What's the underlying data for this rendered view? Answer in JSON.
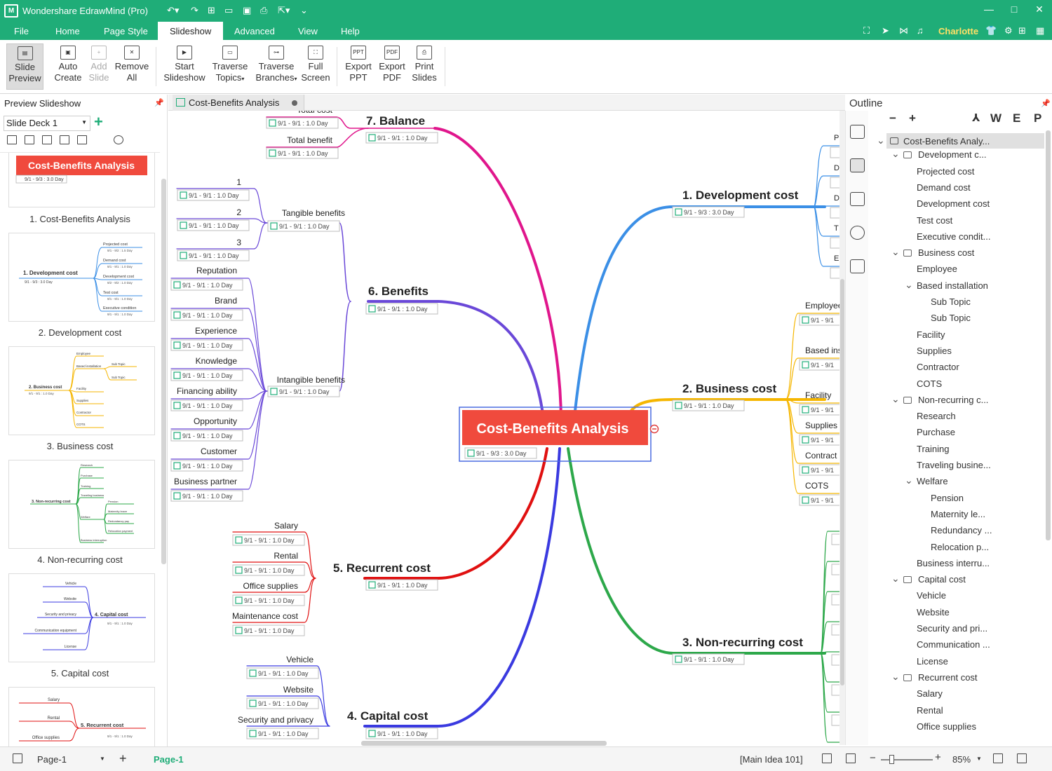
{
  "app": {
    "title": "Wondershare EdrawMind (Pro)",
    "user": "Charlotte"
  },
  "menu": [
    "File",
    "Home",
    "Page Style",
    "Slideshow",
    "Advanced",
    "View",
    "Help"
  ],
  "ribbon": [
    {
      "l1": "Slide",
      "l2": "Preview",
      "icon": "slide-preview-icon"
    },
    {
      "l1": "Auto",
      "l2": "Create",
      "icon": "auto-create-icon"
    },
    {
      "l1": "Add",
      "l2": "Slide",
      "icon": "add-slide-icon"
    },
    {
      "l1": "Remove",
      "l2": "All",
      "icon": "remove-all-icon"
    },
    {
      "l1": "Start",
      "l2": "Slideshow",
      "icon": "start-slideshow-icon"
    },
    {
      "l1": "Traverse",
      "l2": "Topics",
      "icon": "traverse-topics-icon"
    },
    {
      "l1": "Traverse",
      "l2": "Branches",
      "icon": "traverse-branches-icon"
    },
    {
      "l1": "Full",
      "l2": "Screen",
      "icon": "full-screen-icon"
    },
    {
      "l1": "Export",
      "l2": "PPT",
      "icon": "export-ppt-icon"
    },
    {
      "l1": "Export",
      "l2": "PDF",
      "icon": "export-pdf-icon"
    },
    {
      "l1": "Print",
      "l2": "Slides",
      "icon": "print-slides-icon"
    }
  ],
  "left_panel": {
    "title": "Preview Slideshow",
    "deck": "Slide Deck 1",
    "slides": [
      "1. Cost-Benefits Analysis",
      "2. Development cost",
      "3. Business cost",
      "4. Non-recurring cost",
      "5. Capital cost"
    ],
    "thumb_texts": {
      "t1_title": "Cost-Benefits Analysis",
      "t1_tag": "9/1 - 9/3 : 3.0 Day",
      "t2_main": "1. Development cost",
      "t2_tag": "9/1 - 9/3 : 3.0 Day",
      "t2_items": [
        "Projected cost",
        "Demand cost",
        "Development cost",
        "Test cost",
        "Executive condition"
      ],
      "t2_tags": [
        "9/1 - 9/2 : 1.5 Day",
        "9/1 - 9/1 : 1.0 Day",
        "9/2 - 9/2 : 1.0 Day",
        "9/1 - 9/1 : 1.0 Day",
        "9/1 - 9/1 : 1.0 Day"
      ],
      "t3_main": "2. Business cost",
      "t3_tag": "9/1 - 9/1 : 1.0 Day",
      "t3_items": [
        "Employee",
        "Based installation",
        "Facility",
        "Supplies",
        "Contractor",
        "COTS"
      ],
      "t3_sub": [
        "Sub Topic",
        "Sub Topic"
      ],
      "t4_main": "3. Non-recurring cost",
      "t4_items": [
        "Research",
        "Purchase",
        "Training",
        "Traveling business",
        "Welfare",
        "Business interruption"
      ],
      "t4_sub": [
        "Pension",
        "Maternity leave",
        "Redundancy pay",
        "Relocation payment"
      ],
      "t5_main": "4. Capital cost",
      "t5_tag": "9/1 - 9/1 : 1.0 Day",
      "t5_items": [
        "Vehicle",
        "Website",
        "Security and privacy",
        "Communication equipment",
        "License"
      ],
      "t6_main": "5. Recurrent cost",
      "t6_tag": "9/1 - 9/1 : 1.0 Day",
      "t6_items": [
        "Salary",
        "Rental",
        "Office supplies"
      ]
    }
  },
  "doc_tab": "Cost-Benefits Analysis",
  "mindmap": {
    "central": "Cost-Benefits Analysis",
    "central_tag": "9/1 - 9/3 : 3.0 Day",
    "day1": "9/1 - 9/1 : 1.0 Day",
    "day3": "9/1 - 9/3 : 3.0 Day",
    "branches": {
      "b1": "1. Development cost",
      "b2": "2. Business cost",
      "b3": "3. Non-recurring cost",
      "b4": "4. Capital cost",
      "b5": "5. Recurrent cost",
      "b6": "6. Benefits",
      "b7": "7. Balance"
    },
    "balance_items": [
      "Total cost",
      "Total benefit"
    ],
    "tangible": "Tangible benefits",
    "tangible_items": [
      "1",
      "2",
      "3"
    ],
    "intangible": "Intangible benefits",
    "intangible_items": [
      "Reputation",
      "Brand",
      "Experience",
      "Knowledge",
      "Financing ability",
      "Opportunity",
      "Customer",
      "Business partner"
    ],
    "recurrent_items": [
      "Salary",
      "Rental",
      "Office supplies",
      "Maintenance cost"
    ],
    "capital_items": [
      "Vehicle",
      "Website",
      "Security and privacy"
    ],
    "business_items": [
      "Employee",
      "Based ins",
      "Facility",
      "Supplies",
      "Contract",
      "COTS"
    ],
    "business_tag_partial": "9/1 - 9/1",
    "dev_partial": [
      "P",
      "D",
      "D",
      "T",
      "E"
    ]
  },
  "outline": {
    "title": "Outline",
    "tools": [
      "−",
      "+",
      "W",
      "E",
      "P"
    ],
    "rows": [
      {
        "t": "Cost-Benefits Analy...",
        "lvl": 0,
        "kind": "root"
      },
      {
        "t": "Development c...",
        "lvl": 1,
        "kind": "main"
      },
      {
        "t": "Projected cost",
        "lvl": 2
      },
      {
        "t": "Demand cost",
        "lvl": 2
      },
      {
        "t": "Development cost",
        "lvl": 2
      },
      {
        "t": "Test cost",
        "lvl": 2
      },
      {
        "t": "Executive condit...",
        "lvl": 2
      },
      {
        "t": "Business cost",
        "lvl": 1,
        "kind": "main"
      },
      {
        "t": "Employee",
        "lvl": 2
      },
      {
        "t": "Based installation",
        "lvl": 2,
        "kind": "sub"
      },
      {
        "t": "Sub Topic",
        "lvl": 3
      },
      {
        "t": "Sub Topic",
        "lvl": 3
      },
      {
        "t": "Facility",
        "lvl": 2
      },
      {
        "t": "Supplies",
        "lvl": 2
      },
      {
        "t": "Contractor",
        "lvl": 2
      },
      {
        "t": "COTS",
        "lvl": 2
      },
      {
        "t": "Non-recurring c...",
        "lvl": 1,
        "kind": "main"
      },
      {
        "t": "Research",
        "lvl": 2
      },
      {
        "t": "Purchase",
        "lvl": 2
      },
      {
        "t": "Training",
        "lvl": 2
      },
      {
        "t": "Traveling busine...",
        "lvl": 2
      },
      {
        "t": "Welfare",
        "lvl": 2,
        "kind": "sub"
      },
      {
        "t": "Pension",
        "lvl": 3
      },
      {
        "t": "Maternity le...",
        "lvl": 3
      },
      {
        "t": "Redundancy ...",
        "lvl": 3
      },
      {
        "t": "Relocation p...",
        "lvl": 3
      },
      {
        "t": "Business interru...",
        "lvl": 2
      },
      {
        "t": "Capital cost",
        "lvl": 1,
        "kind": "main"
      },
      {
        "t": "Vehicle",
        "lvl": 2
      },
      {
        "t": "Website",
        "lvl": 2
      },
      {
        "t": "Security and pri...",
        "lvl": 2
      },
      {
        "t": "Communication ...",
        "lvl": 2
      },
      {
        "t": "License",
        "lvl": 2
      },
      {
        "t": "Recurrent cost",
        "lvl": 1,
        "kind": "main"
      },
      {
        "t": "Salary",
        "lvl": 2
      },
      {
        "t": "Rental",
        "lvl": 2
      },
      {
        "t": "Office supplies",
        "lvl": 2
      }
    ]
  },
  "status": {
    "page": "Page-1",
    "current": "Page-1",
    "main_idea": "[Main Idea 101]",
    "zoom": "85%"
  },
  "colors": {
    "brand": "#1fad78",
    "central": "#f04a3d",
    "dev": "#3b8fe6",
    "business": "#f5b600",
    "nonrec": "#2da84a",
    "capital": "#3a3ae0",
    "recurrent": "#e01010",
    "benefits": "#6a48d8",
    "balance": "#e0168c"
  }
}
